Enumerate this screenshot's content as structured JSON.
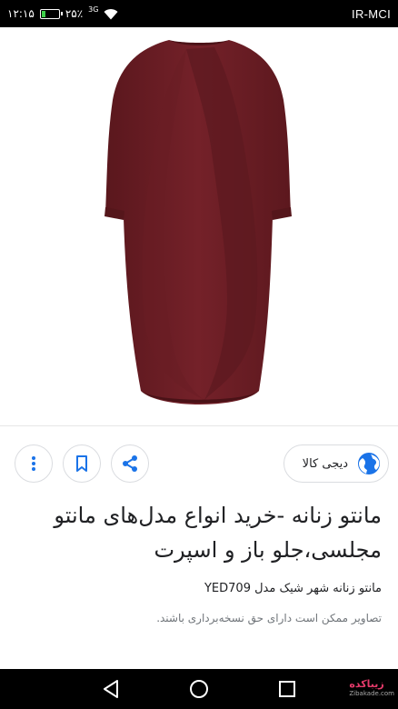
{
  "status_bar": {
    "time": "۱۲:۱۵",
    "battery_percent": "۲۵٪",
    "battery_level": 0.25,
    "network_badge": "3G",
    "carrier": "IR-MCI"
  },
  "image": {
    "description_icon": "garment-photo",
    "garment_color": "#6e2027"
  },
  "actions": {
    "more_icon": "more-vert-icon",
    "save_icon": "bookmark-icon",
    "share_icon": "share-icon"
  },
  "source": {
    "label": "دیجی کالا",
    "icon": "globe-icon"
  },
  "result": {
    "title": "مانتو زنانه -خرید انواع مدل‌های مانتو مجلسی،جلو باز و اسپرت",
    "subtitle": "مانتو زنانه شهر شیک مدل YED709",
    "copyright_notice": "تصاویر ممکن است دارای حق نسخه‌برداری باشند."
  },
  "nav": {
    "back_icon": "back-triangle-icon",
    "home_icon": "home-circle-icon",
    "recents_icon": "recents-square-icon"
  },
  "watermark": {
    "text": "زیباکده",
    "sub": "Zibakade.com"
  }
}
